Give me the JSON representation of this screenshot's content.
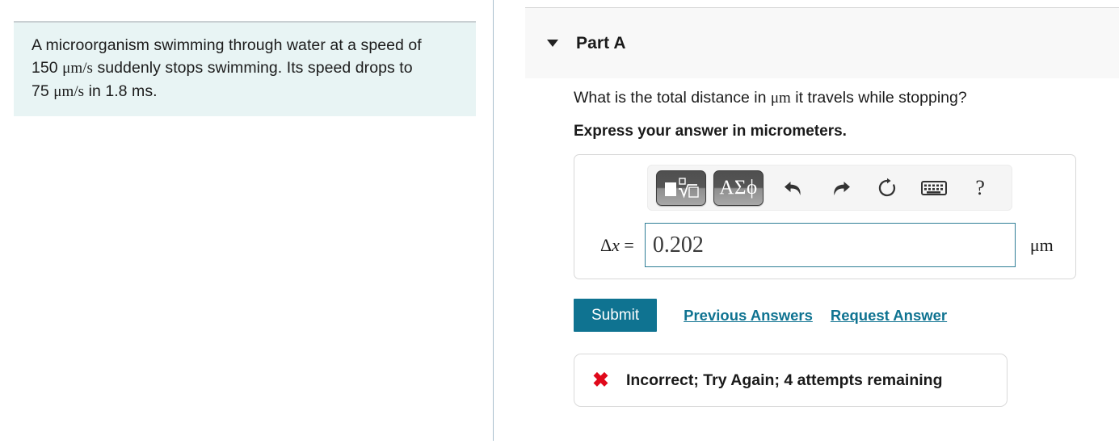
{
  "problem": {
    "line1": "A microorganism swimming through water at a speed of",
    "line2_prefix": "150 ",
    "line2_unit": "μm/s",
    "line2_suffix": " suddenly stops swimming. Its speed drops to",
    "line3_prefix": "75 ",
    "line3_unit": "μm/s",
    "line3_suffix": " in 1.8 ms.",
    "full_text": "A microorganism swimming through water at a speed of 150 μm/s suddenly stops swimming. Its speed drops to 75 μm/s in 1.8 ms."
  },
  "part": {
    "title": "Part A",
    "caret_icon": "chevron-down-icon",
    "question_prefix": "What is the total distance in ",
    "question_unit": "μm",
    "question_suffix": " it travels while stopping?",
    "instruction": "Express your answer in micrometers."
  },
  "toolbar": {
    "template_button_label": "■√□",
    "greek_button_label": "ΑΣϕ",
    "undo_icon": "undo-arrow-icon",
    "redo_icon": "redo-arrow-icon",
    "reset_icon": "reset-circle-icon",
    "keyboard_icon": "keyboard-icon",
    "help_label": "?"
  },
  "answer": {
    "variable_label": "Δx =",
    "value": "0.202",
    "placeholder": "",
    "unit": "μm",
    "input_border_color": "#2f7e96"
  },
  "actions": {
    "submit_label": "Submit",
    "previous_answers_label": "Previous Answers",
    "request_answer_label": "Request Answer",
    "accent_color": "#0f7391"
  },
  "feedback": {
    "icon": "x-mark-icon",
    "icon_color": "#e0091b",
    "message": "Incorrect; Try Again; 4 attempts remaining"
  }
}
